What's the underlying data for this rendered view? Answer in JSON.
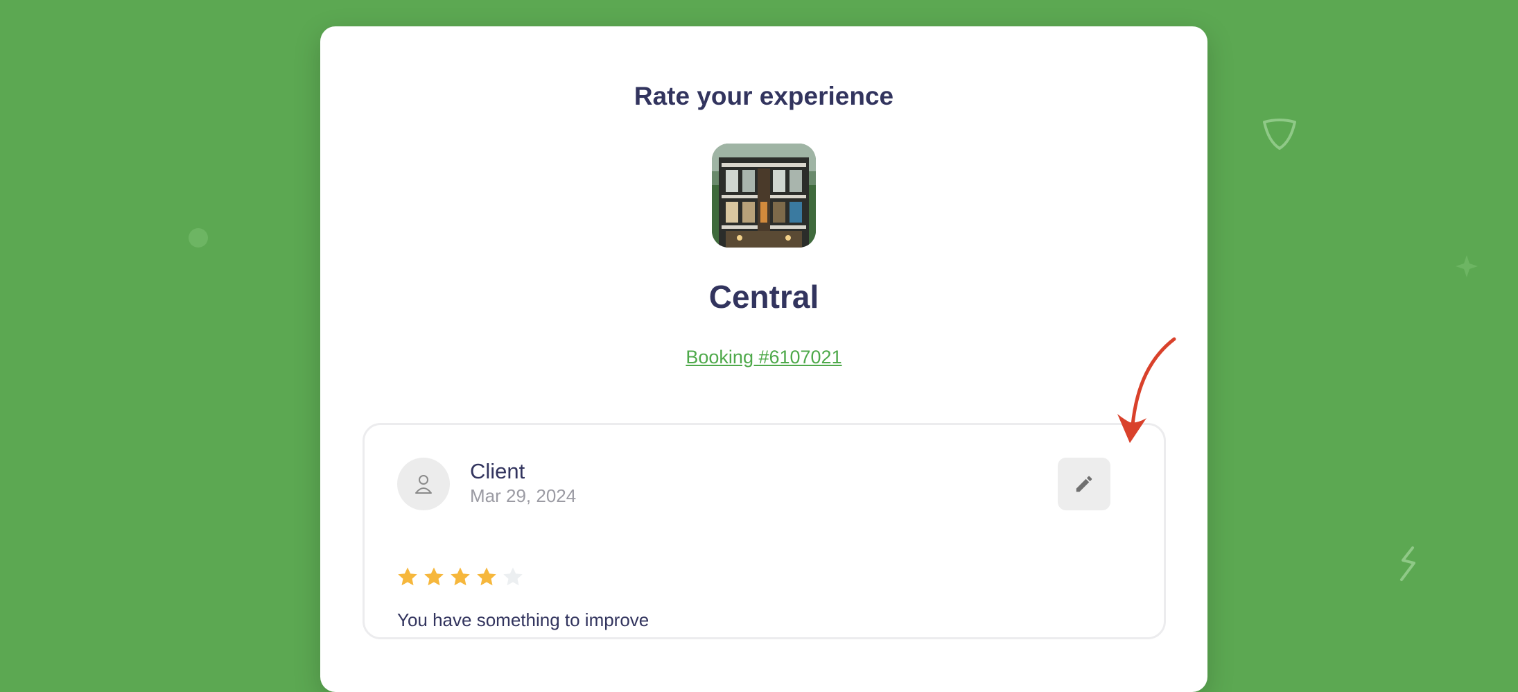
{
  "title": "Rate your experience",
  "hotel": {
    "name": "Central",
    "image_alt": "hotel building photo"
  },
  "booking": {
    "label": "Booking #6107021"
  },
  "review": {
    "author": "Client",
    "date": "Mar 29, 2024",
    "rating": 4,
    "max_rating": 5,
    "comment": "You have something to improve"
  },
  "icons": {
    "avatar": "user-icon",
    "edit": "pencil-icon",
    "star_filled": "star-filled-icon",
    "star_empty": "star-empty-icon",
    "annotation": "red-arrow-annotation"
  },
  "colors": {
    "background": "#5ca852",
    "card": "#ffffff",
    "heading": "#32345e",
    "link": "#4ea94a",
    "star_filled": "#f6b73c",
    "star_empty": "#eceff1",
    "arrow": "#d9412b"
  }
}
